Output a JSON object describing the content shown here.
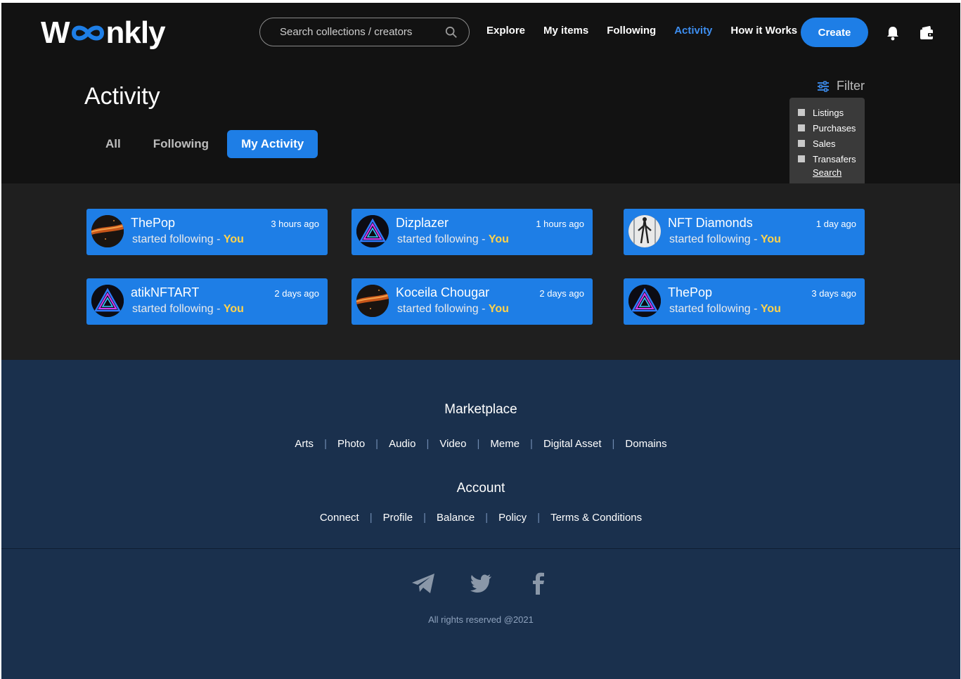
{
  "brand": {
    "logo_pre": "W",
    "logo_post": "nkly"
  },
  "search": {
    "placeholder": "Search collections / creators"
  },
  "nav": {
    "items": [
      "Explore",
      "My items",
      "Following",
      "Activity",
      "How it Works"
    ],
    "active": "Activity"
  },
  "header": {
    "create_label": "Create"
  },
  "page": {
    "title": "Activity",
    "tabs": [
      "All",
      "Following",
      "My Activity"
    ],
    "active_tab": "My Activity"
  },
  "filter": {
    "label": "Filter",
    "options": [
      "Listings",
      "Purchases",
      "Sales",
      "Transafers"
    ],
    "search_label": "Search"
  },
  "activities": [
    {
      "name": "ThePop",
      "time": "3 hours ago",
      "action": "started following -",
      "target": "You",
      "avatar": "ember"
    },
    {
      "name": "Dizplazer",
      "time": "1 hours ago",
      "action": "started following -",
      "target": "You",
      "avatar": "triangle"
    },
    {
      "name": "NFT Diamonds",
      "time": "1 day ago",
      "action": "started following -",
      "target": "You",
      "avatar": "figure"
    },
    {
      "name": "atikNFTART",
      "time": "2 days ago",
      "action": "started following -",
      "target": "You",
      "avatar": "triangle"
    },
    {
      "name": "Koceila Chougar",
      "time": "2 days  ago",
      "action": "started following -",
      "target": "You",
      "avatar": "ember"
    },
    {
      "name": "ThePop",
      "time": "3 days ago",
      "action": "started following -",
      "target": "You",
      "avatar": "triangle"
    }
  ],
  "footer": {
    "marketplace_title": "Marketplace",
    "marketplace_links": [
      "Arts",
      "Photo",
      "Audio",
      "Video",
      "Meme",
      "Digital Asset",
      "Domains"
    ],
    "account_title": "Account",
    "account_links": [
      "Connect",
      "Profile",
      "Balance",
      "Policy",
      "Terms & Conditions"
    ],
    "social": [
      "telegram-icon",
      "twitter-icon",
      "facebook-icon"
    ],
    "copyright": "All rights reserved @2021"
  },
  "colors": {
    "accent": "#1e7ee6",
    "highlight": "#ffd24a",
    "footer_bg": "#1a304d",
    "page_bg": "#121212"
  }
}
